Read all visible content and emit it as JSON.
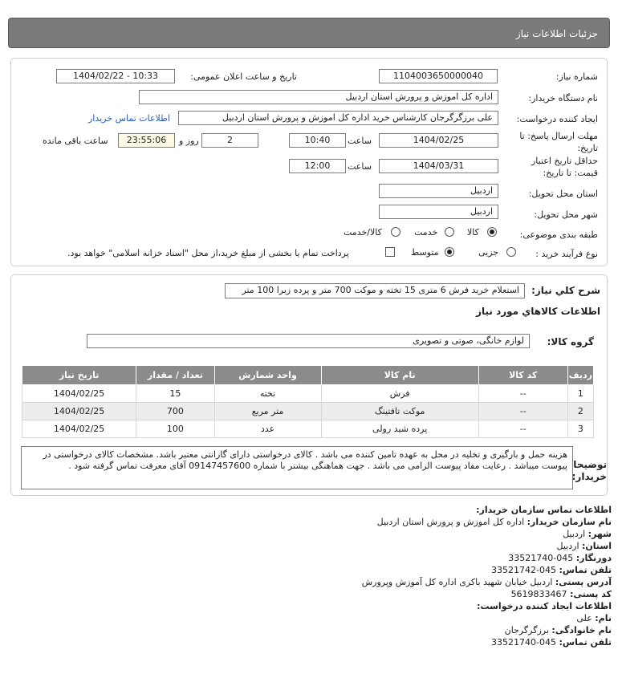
{
  "header": {
    "title": "جزئیات اطلاعات نیاز"
  },
  "form": {
    "need_number_label": "شماره نیاز:",
    "need_number": "1104003650000040",
    "announce_label": "تاریخ و ساعت اعلان عمومی:",
    "announce_value": "1404/02/22 - 10:33",
    "buyer_org_label": "نام دستگاه خریدار:",
    "buyer_org": "اداره کل اموزش و پرورش استان اردبیل",
    "creator_label": "ایجاد کننده درخواست:",
    "creator": "علی برزگرگرجان کارشناس خرید اداره کل اموزش و پرورش استان اردبیل",
    "buyer_contact_link": "اطلاعات تماس خریدار",
    "deadline_label_1": "مهلت ارسال پاسخ: تا",
    "deadline_label_2": "تاریخ:",
    "deadline_date": "1404/02/25",
    "time_label": "ساعت",
    "deadline_time": "10:40",
    "days_value": "2",
    "days_label": "روز و",
    "remaining_time": "23:55:06",
    "remaining_label": "ساعت باقی مانده",
    "validity_label_1": "حداقل تاریخ اعتبار",
    "validity_label_2": "قیمت: تا تاریخ:",
    "validity_date": "1404/03/31",
    "validity_time_label": "ساعت",
    "validity_time": "12:00",
    "province_label": "استان محل تحویل:",
    "province": "اردبیل",
    "city_label": "شهر محل تحویل:",
    "city": "اردبیل",
    "category_label": "طبقه بندی موضوعی:",
    "category_options": [
      "کالا",
      "خدمت",
      "کالا/خدمت"
    ],
    "process_label": "نوع فرآیند خرید :",
    "process_options": [
      "جزیی",
      "متوسط"
    ],
    "treasury_note": "پرداخت تمام یا بخشی از مبلغ خرید،از محل \"اسناد خزانه اسلامی\" خواهد بود."
  },
  "summary": {
    "label": "شرح كلي نياز:",
    "value": "استعلام خرید فرش 6 متری 15 تخته و موکت 700 متر و پرده زبرا 100 متر",
    "goods_info_title": "اطلاعات کالاهاي مورد نياز",
    "group_label": "گروه کالا:",
    "group_value": "لوازم خانگی، صوتی و تصویری"
  },
  "table": {
    "headers": [
      "ردیف",
      "کد کالا",
      "نام کالا",
      "واحد شمارش",
      "تعداد / مقدار",
      "تاریخ نیاز"
    ],
    "rows": [
      [
        "1",
        "--",
        "فرش",
        "تخته",
        "15",
        "1404/02/25"
      ],
      [
        "2",
        "--",
        "موکت تافتینگ",
        "متر مربع",
        "700",
        "1404/02/25"
      ],
      [
        "3",
        "--",
        "پرده شید رولی",
        "عدد",
        "100",
        "1404/02/25"
      ]
    ]
  },
  "buyer_notes": {
    "label_1": "توضیحات",
    "label_2": "خریدار:",
    "text": "هزینه حمل و بارگیری و تخلیه در محل به عهده تامین کننده می باشد . کالای درخواستی دارای گارانتی معتبر باشد. مشخصات کالای درخواستی در پیوست میباشد . رعایت مفاد پیوست الزامی می باشد . جهت هماهنگی بیشتر با شماره 09147457600 آقای معرفت تماس گرفته شود ."
  },
  "contact": {
    "org_title": "اطلاعات تماس سازمان خریدار:",
    "org_name_label": "نام سازمان خریدار:",
    "org_name": "اداره کل اموزش و پرورش استان اردبیل",
    "city_label": "شهر:",
    "city": "اردبیل",
    "province_label": "استان:",
    "province": "اردبیل",
    "fax_label": "دورنگار:",
    "fax": "045-33521740",
    "phone_label": "تلفن تماس:",
    "phone": "045-33521742",
    "address_label": "آدرس پستی:",
    "address": "اردبیل خیابان شهید باکری اداره کل آموزش وپرورش",
    "postal_label": "کد پستی:",
    "postal": "5619833467",
    "creator_title": "اطلاعات ایجاد کننده درخواست:",
    "first_name_label": "نام:",
    "first_name": "علی",
    "last_name_label": "نام خانوادگی:",
    "last_name": "برزگرگرجان",
    "creator_phone_label": "تلفن تماس:",
    "creator_phone": "045-33521740"
  },
  "colors": {
    "header_bg": "#7a7a7a",
    "table_header_bg": "#8b8b8b",
    "link": "#2a5db0",
    "remaining_bg": "#fdfbe6"
  }
}
